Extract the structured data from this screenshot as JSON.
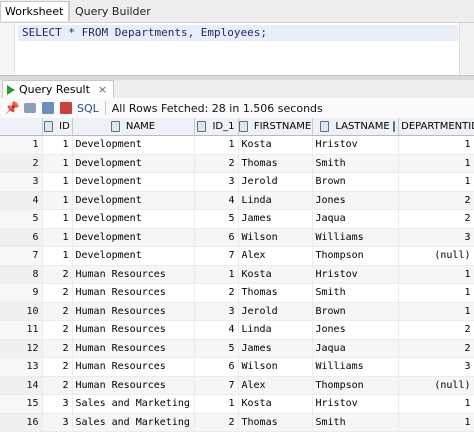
{
  "tabs": {
    "worksheet": "Worksheet",
    "query_builder": "Query Builder"
  },
  "editor": {
    "sql": "SELECT * FROM Departments, Employees;"
  },
  "results": {
    "tab_label": "Query Result",
    "close": "×",
    "sql_button": "SQL",
    "status": "All Rows Fetched: 28 in 1.506 seconds"
  },
  "grid": {
    "columns": [
      "ID",
      "NAME",
      "ID_1",
      "FIRSTNAME",
      "LASTNAME",
      "DEPARTMENTID"
    ],
    "rows": [
      [
        "1",
        "1",
        "Development",
        "1",
        "Kosta",
        "Hristov",
        "1"
      ],
      [
        "2",
        "1",
        "Development",
        "2",
        "Thomas",
        "Smith",
        "1"
      ],
      [
        "3",
        "1",
        "Development",
        "3",
        "Jerold",
        "Brown",
        "1"
      ],
      [
        "4",
        "1",
        "Development",
        "4",
        "Linda",
        "Jones",
        "2"
      ],
      [
        "5",
        "1",
        "Development",
        "5",
        "James",
        "Jaqua",
        "2"
      ],
      [
        "6",
        "1",
        "Development",
        "6",
        "Wilson",
        "Williams",
        "3"
      ],
      [
        "7",
        "1",
        "Development",
        "7",
        "Alex",
        "Thompson",
        "(null)"
      ],
      [
        "8",
        "2",
        "Human Resources",
        "1",
        "Kosta",
        "Hristov",
        "1"
      ],
      [
        "9",
        "2",
        "Human Resources",
        "2",
        "Thomas",
        "Smith",
        "1"
      ],
      [
        "10",
        "2",
        "Human Resources",
        "3",
        "Jerold",
        "Brown",
        "1"
      ],
      [
        "11",
        "2",
        "Human Resources",
        "4",
        "Linda",
        "Jones",
        "2"
      ],
      [
        "12",
        "2",
        "Human Resources",
        "5",
        "James",
        "Jaqua",
        "2"
      ],
      [
        "13",
        "2",
        "Human Resources",
        "6",
        "Wilson",
        "Williams",
        "3"
      ],
      [
        "14",
        "2",
        "Human Resources",
        "7",
        "Alex",
        "Thompson",
        "(null)"
      ],
      [
        "15",
        "3",
        "Sales and Marketing",
        "1",
        "Kosta",
        "Hristov",
        "1"
      ],
      [
        "16",
        "3",
        "Sales and Marketing",
        "2",
        "Thomas",
        "Smith",
        "1"
      ]
    ]
  },
  "colors": {
    "play": "#2b9a2b",
    "sql_text": "#1a2a6c",
    "header_bg": "#eef1f5"
  }
}
